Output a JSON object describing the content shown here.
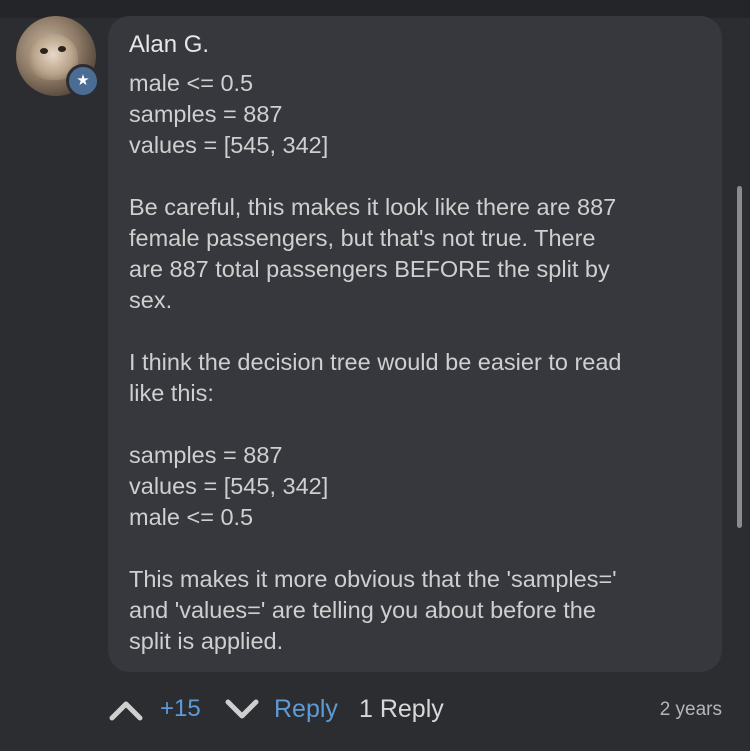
{
  "comment": {
    "author": "Alan G.",
    "badge_icon": "star-icon",
    "paragraphs": [
      "male <= 0.5\nsamples = 887\nvalues = [545, 342]",
      "Be careful, this makes it look like there are 887\nfemale passengers, but that's not true. There\nare 887 total passengers BEFORE the split by\nsex.",
      "I think the decision tree would be easier to read\nlike this:",
      "samples = 887\nvalues = [545, 342]\nmale <= 0.5",
      "This makes it more obvious that the 'samples='\nand 'values=' are telling you about before the\nsplit is applied."
    ]
  },
  "actions": {
    "upvote_icon": "chevron-up-icon",
    "score": "+15",
    "downvote_icon": "chevron-down-icon",
    "reply_label": "Reply",
    "replies_label": "1 Reply",
    "timestamp": "2 years"
  },
  "colors": {
    "background": "#2b2d31",
    "bubble": "#36383d",
    "accent": "#5e9bd6",
    "badge": "#4b6d93"
  }
}
